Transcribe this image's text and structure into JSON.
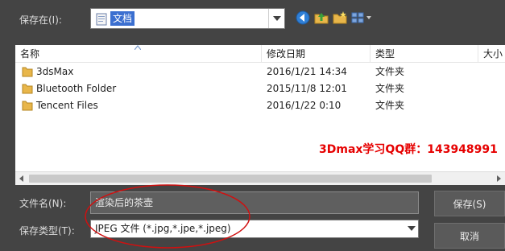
{
  "save_in": {
    "label": "保存在(I):",
    "value": "文档"
  },
  "toolbar": {
    "back_icon": "back-arrow-icon",
    "up_icon": "up-folder-icon",
    "new_folder_icon": "new-folder-icon",
    "view_icon": "view-menu-icon"
  },
  "columns": {
    "name": "名称",
    "modified": "修改日期",
    "type": "类型",
    "size": "大小"
  },
  "files": [
    {
      "name": "3dsMax",
      "modified": "2016/1/21 14:34",
      "type": "文件夹"
    },
    {
      "name": "Bluetooth Folder",
      "modified": "2015/11/8 12:01",
      "type": "文件夹"
    },
    {
      "name": "Tencent Files",
      "modified": "2016/1/22 0:10",
      "type": "文件夹"
    }
  ],
  "watermark": "3Dmax学习QQ群：143948991",
  "filename": {
    "label": "文件名(N):",
    "value": "渲染后的茶壶"
  },
  "filetype": {
    "label": "保存类型(T):",
    "value": "JPEG 文件 (*.jpg,*.jpe,*.jpeg)"
  },
  "buttons": {
    "save": "保存(S)",
    "cancel": "取消"
  },
  "colors": {
    "dialog_bg": "#444444",
    "selection": "#3b6fd0",
    "folder": "#e8b64a",
    "annotation": "#e60000"
  }
}
